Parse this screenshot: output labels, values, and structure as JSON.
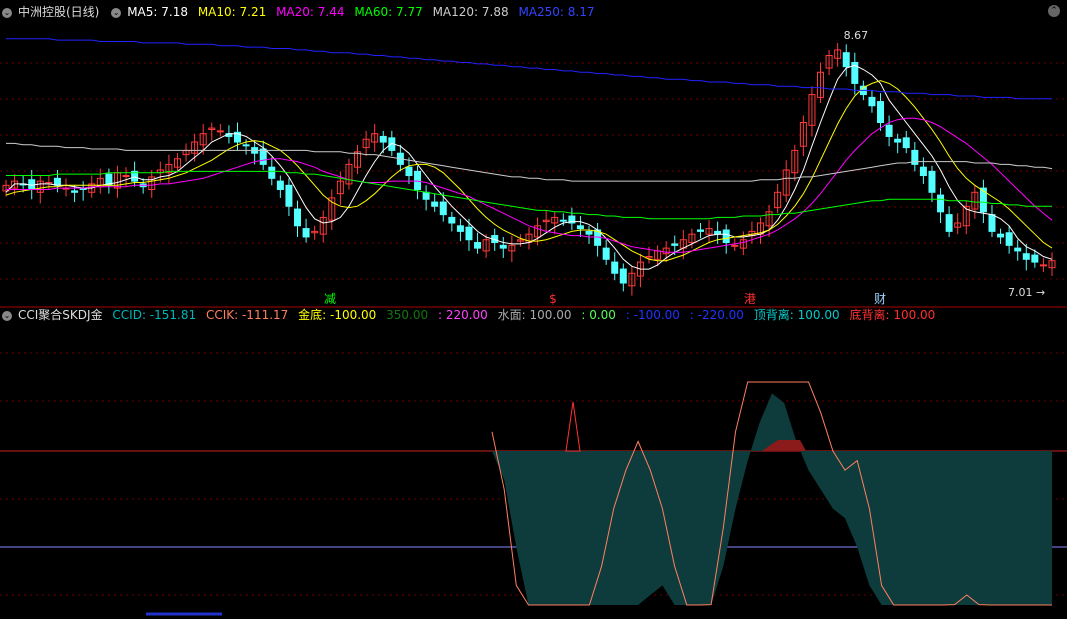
{
  "colors": {
    "up": "#ff3a3a",
    "down": "#54ffff",
    "bg": "#000000",
    "ma5": "#ffffff",
    "ma10": "#ffff00",
    "ma20": "#ff00ff",
    "ma60": "#00ff00",
    "ma120": "#cccccc",
    "ma250": "#2222ff",
    "grid": "#6b0000",
    "ccid": "#00b7b7",
    "ccik": "#ff8060",
    "jindi": "#ffff00",
    "ding": "#00cccc",
    "di": "#ff3030"
  },
  "top_legend": {
    "title": "中洲控股(日线)",
    "ma5": "MA5: 7.18",
    "ma10": "MA10: 7.21",
    "ma20": "MA20: 7.44",
    "ma60": "MA60: 7.77",
    "ma120": "MA120: 7.88",
    "ma250": "MA250: 8.17"
  },
  "bottom_legend": {
    "title": "CCI聚合SKDJ金",
    "ccid": "CCID: -151.81",
    "ccik": "CCIK: -111.17",
    "jindi": "金底: -100.00",
    "v350": "350.00",
    "v220": ": 220.00",
    "shuimian": "水面: 100.00",
    "v0": ": 0.00",
    "vm100": ": -100.00",
    "vm220": ": -220.00",
    "dingbeili": "顶背离: 100.00",
    "dibeili": "底背离: 100.00"
  },
  "annotations": {
    "high_label": "8.67",
    "low_label": "7.01",
    "markers": [
      {
        "text": "减",
        "color": "#00ff00"
      },
      {
        "text": "$",
        "color": "#ff3030"
      },
      {
        "text": "港",
        "color": "#ff3030"
      },
      {
        "text": "财",
        "color": "#9fd0ff"
      }
    ]
  },
  "chart_data": [
    {
      "type": "candlestick",
      "title": "中洲控股(日线)",
      "high": 8.67,
      "low": 7.01,
      "close": [
        7.55,
        7.58,
        7.56,
        7.52,
        7.58,
        7.57,
        7.55,
        7.53,
        7.5,
        7.52,
        7.56,
        7.6,
        7.55,
        7.64,
        7.62,
        7.58,
        7.54,
        7.61,
        7.66,
        7.7,
        7.74,
        7.8,
        7.86,
        7.92,
        7.96,
        7.94,
        7.9,
        7.86,
        7.84,
        7.78,
        7.7,
        7.6,
        7.52,
        7.4,
        7.26,
        7.18,
        7.22,
        7.32,
        7.46,
        7.58,
        7.7,
        7.79,
        7.88,
        7.92,
        7.86,
        7.8,
        7.7,
        7.62,
        7.52,
        7.45,
        7.4,
        7.34,
        7.28,
        7.22,
        7.16,
        7.1,
        7.16,
        7.14,
        7.1,
        7.12,
        7.16,
        7.2,
        7.26,
        7.3,
        7.32,
        7.3,
        7.28,
        7.24,
        7.2,
        7.12,
        7.02,
        6.92,
        6.85,
        6.92,
        7.0,
        7.04,
        7.08,
        7.1,
        7.12,
        7.16,
        7.2,
        7.22,
        7.24,
        7.2,
        7.14,
        7.12,
        7.16,
        7.22,
        7.28,
        7.36,
        7.5,
        7.66,
        7.8,
        8.0,
        8.2,
        8.36,
        8.48,
        8.52,
        8.4,
        8.28,
        8.2,
        8.12,
        8.0,
        7.9,
        7.86,
        7.82,
        7.7,
        7.62,
        7.5,
        7.36,
        7.22,
        7.28,
        7.4,
        7.5,
        7.36,
        7.22,
        7.18,
        7.12,
        7.08,
        7.02,
        7.0,
        6.98,
        7.01
      ],
      "series": [
        {
          "name": "MA5",
          "values": [
            7.5,
            7.56,
            7.56,
            7.55,
            7.56,
            7.56,
            7.55,
            7.55,
            7.54,
            7.53,
            7.53,
            7.55,
            7.56,
            7.57,
            7.59,
            7.61,
            7.59,
            7.59,
            7.61,
            7.62,
            7.65,
            7.7,
            7.75,
            7.8,
            7.86,
            7.89,
            7.92,
            7.92,
            7.9,
            7.86,
            7.82,
            7.76,
            7.69,
            7.61,
            7.5,
            7.39,
            7.31,
            7.28,
            7.29,
            7.32,
            7.4,
            7.51,
            7.62,
            7.72,
            7.8,
            7.85,
            7.83,
            7.78,
            7.7,
            7.62,
            7.54,
            7.47,
            7.4,
            7.34,
            7.28,
            7.22,
            7.18,
            7.16,
            7.14,
            7.13,
            7.13,
            7.14,
            7.17,
            7.21,
            7.25,
            7.28,
            7.29,
            7.29,
            7.27,
            7.23,
            7.17,
            7.1,
            7.02,
            6.97,
            6.95,
            6.95,
            6.98,
            7.03,
            7.07,
            7.1,
            7.13,
            7.16,
            7.19,
            7.2,
            7.2,
            7.18,
            7.18,
            7.19,
            7.2,
            7.23,
            7.3,
            7.4,
            7.52,
            7.66,
            7.83,
            8.0,
            8.16,
            8.31,
            8.39,
            8.41,
            8.38,
            8.34,
            8.28,
            8.16,
            8.08,
            8.0,
            7.92,
            7.84,
            7.76,
            7.66,
            7.54,
            7.44,
            7.38,
            7.36,
            7.35,
            7.34,
            7.31,
            7.26,
            7.17,
            7.11,
            7.08,
            7.04,
            7.02
          ]
        },
        {
          "name": "MA10",
          "values": [
            7.48,
            7.5,
            7.51,
            7.52,
            7.53,
            7.54,
            7.54,
            7.55,
            7.55,
            7.55,
            7.55,
            7.55,
            7.55,
            7.55,
            7.56,
            7.57,
            7.57,
            7.58,
            7.59,
            7.6,
            7.62,
            7.64,
            7.67,
            7.7,
            7.73,
            7.77,
            7.81,
            7.84,
            7.86,
            7.87,
            7.86,
            7.83,
            7.8,
            7.75,
            7.69,
            7.62,
            7.55,
            7.48,
            7.43,
            7.4,
            7.39,
            7.4,
            7.44,
            7.49,
            7.55,
            7.61,
            7.66,
            7.69,
            7.7,
            7.7,
            7.68,
            7.64,
            7.58,
            7.52,
            7.45,
            7.38,
            7.32,
            7.27,
            7.23,
            7.2,
            7.17,
            7.15,
            7.15,
            7.16,
            7.18,
            7.2,
            7.22,
            7.23,
            7.23,
            7.22,
            7.2,
            7.16,
            7.12,
            7.08,
            7.05,
            7.02,
            7.01,
            7.01,
            7.03,
            7.05,
            7.08,
            7.11,
            7.14,
            7.16,
            7.17,
            7.18,
            7.19,
            7.2,
            7.21,
            7.23,
            7.27,
            7.33,
            7.4,
            7.49,
            7.6,
            7.73,
            7.86,
            7.99,
            8.1,
            8.19,
            8.25,
            8.28,
            8.3,
            8.28,
            8.24,
            8.18,
            8.11,
            8.03,
            7.95,
            7.86,
            7.76,
            7.67,
            7.6,
            7.55,
            7.51,
            7.47,
            7.43,
            7.38,
            7.32,
            7.26,
            7.2,
            7.14,
            7.1
          ]
        },
        {
          "name": "MA20",
          "values": [
            7.52,
            7.52,
            7.52,
            7.52,
            7.52,
            7.52,
            7.53,
            7.53,
            7.53,
            7.53,
            7.54,
            7.54,
            7.54,
            7.54,
            7.54,
            7.55,
            7.55,
            7.55,
            7.56,
            7.56,
            7.57,
            7.58,
            7.59,
            7.6,
            7.62,
            7.64,
            7.66,
            7.68,
            7.7,
            7.72,
            7.73,
            7.74,
            7.74,
            7.73,
            7.72,
            7.7,
            7.68,
            7.65,
            7.63,
            7.61,
            7.59,
            7.58,
            7.57,
            7.57,
            7.57,
            7.58,
            7.58,
            7.58,
            7.58,
            7.57,
            7.55,
            7.53,
            7.51,
            7.49,
            7.47,
            7.44,
            7.41,
            7.38,
            7.35,
            7.32,
            7.29,
            7.26,
            7.24,
            7.22,
            7.21,
            7.2,
            7.19,
            7.19,
            7.18,
            7.18,
            7.17,
            7.15,
            7.13,
            7.11,
            7.1,
            7.09,
            7.08,
            7.07,
            7.07,
            7.07,
            7.08,
            7.09,
            7.1,
            7.11,
            7.12,
            7.13,
            7.14,
            7.16,
            7.18,
            7.2,
            7.23,
            7.27,
            7.31,
            7.36,
            7.42,
            7.49,
            7.57,
            7.65,
            7.73,
            7.8,
            7.86,
            7.92,
            7.96,
            8.0,
            8.02,
            8.03,
            8.03,
            8.02,
            8.0,
            7.97,
            7.93,
            7.89,
            7.85,
            7.8,
            7.75,
            7.7,
            7.64,
            7.58,
            7.52,
            7.46,
            7.4,
            7.35,
            7.3
          ]
        },
        {
          "name": "MA60",
          "values": [
            7.62,
            7.62,
            7.62,
            7.62,
            7.62,
            7.62,
            7.63,
            7.63,
            7.63,
            7.63,
            7.63,
            7.63,
            7.64,
            7.64,
            7.64,
            7.64,
            7.64,
            7.64,
            7.64,
            7.65,
            7.65,
            7.65,
            7.65,
            7.65,
            7.65,
            7.65,
            7.65,
            7.65,
            7.65,
            7.65,
            7.65,
            7.65,
            7.65,
            7.64,
            7.64,
            7.63,
            7.63,
            7.62,
            7.61,
            7.6,
            7.59,
            7.58,
            7.57,
            7.56,
            7.55,
            7.54,
            7.53,
            7.52,
            7.51,
            7.5,
            7.49,
            7.48,
            7.47,
            7.46,
            7.45,
            7.44,
            7.43,
            7.42,
            7.41,
            7.4,
            7.39,
            7.38,
            7.37,
            7.37,
            7.36,
            7.36,
            7.35,
            7.35,
            7.34,
            7.34,
            7.33,
            7.33,
            7.32,
            7.32,
            7.32,
            7.31,
            7.31,
            7.31,
            7.31,
            7.31,
            7.31,
            7.31,
            7.31,
            7.32,
            7.32,
            7.32,
            7.33,
            7.33,
            7.33,
            7.34,
            7.34,
            7.35,
            7.35,
            7.36,
            7.37,
            7.38,
            7.39,
            7.4,
            7.41,
            7.42,
            7.43,
            7.44,
            7.44,
            7.45,
            7.45,
            7.45,
            7.45,
            7.45,
            7.45,
            7.45,
            7.44,
            7.44,
            7.44,
            7.43,
            7.43,
            7.42,
            7.42,
            7.41,
            7.41,
            7.4,
            7.4,
            7.4,
            7.4
          ]
        },
        {
          "name": "MA120",
          "values": [
            7.85,
            7.85,
            7.84,
            7.84,
            7.83,
            7.83,
            7.83,
            7.82,
            7.82,
            7.82,
            7.81,
            7.81,
            7.81,
            7.81,
            7.8,
            7.8,
            7.8,
            7.8,
            7.8,
            7.8,
            7.8,
            7.8,
            7.8,
            7.8,
            7.8,
            7.8,
            7.8,
            7.8,
            7.8,
            7.8,
            7.8,
            7.8,
            7.8,
            7.8,
            7.8,
            7.8,
            7.79,
            7.79,
            7.79,
            7.79,
            7.78,
            7.78,
            7.77,
            7.77,
            7.76,
            7.75,
            7.74,
            7.73,
            7.72,
            7.71,
            7.7,
            7.69,
            7.68,
            7.67,
            7.66,
            7.65,
            7.64,
            7.63,
            7.62,
            7.61,
            7.61,
            7.6,
            7.6,
            7.59,
            7.59,
            7.59,
            7.58,
            7.58,
            7.58,
            7.58,
            7.58,
            7.58,
            7.58,
            7.58,
            7.58,
            7.58,
            7.58,
            7.58,
            7.58,
            7.58,
            7.58,
            7.58,
            7.58,
            7.58,
            7.58,
            7.58,
            7.58,
            7.58,
            7.59,
            7.59,
            7.59,
            7.6,
            7.6,
            7.61,
            7.61,
            7.62,
            7.63,
            7.64,
            7.65,
            7.66,
            7.67,
            7.68,
            7.69,
            7.7,
            7.71,
            7.71,
            7.72,
            7.72,
            7.72,
            7.72,
            7.72,
            7.72,
            7.72,
            7.71,
            7.71,
            7.71,
            7.7,
            7.7,
            7.69,
            7.69,
            7.68,
            7.68,
            7.67
          ]
        },
        {
          "name": "MA250",
          "values": [
            8.6,
            8.6,
            8.6,
            8.6,
            8.6,
            8.6,
            8.59,
            8.59,
            8.59,
            8.59,
            8.59,
            8.58,
            8.58,
            8.58,
            8.58,
            8.58,
            8.57,
            8.57,
            8.57,
            8.57,
            8.57,
            8.56,
            8.56,
            8.56,
            8.56,
            8.55,
            8.55,
            8.55,
            8.54,
            8.54,
            8.54,
            8.53,
            8.53,
            8.53,
            8.52,
            8.52,
            8.51,
            8.51,
            8.5,
            8.5,
            8.5,
            8.49,
            8.49,
            8.48,
            8.48,
            8.47,
            8.47,
            8.46,
            8.46,
            8.45,
            8.45,
            8.44,
            8.44,
            8.43,
            8.43,
            8.42,
            8.42,
            8.41,
            8.41,
            8.4,
            8.4,
            8.39,
            8.39,
            8.38,
            8.38,
            8.37,
            8.37,
            8.36,
            8.36,
            8.35,
            8.35,
            8.34,
            8.34,
            8.33,
            8.33,
            8.32,
            8.32,
            8.31,
            8.31,
            8.31,
            8.3,
            8.3,
            8.29,
            8.29,
            8.29,
            8.28,
            8.28,
            8.27,
            8.27,
            8.27,
            8.26,
            8.26,
            8.26,
            8.25,
            8.25,
            8.25,
            8.24,
            8.24,
            8.24,
            8.23,
            8.23,
            8.23,
            8.22,
            8.22,
            8.22,
            8.21,
            8.21,
            8.21,
            8.2,
            8.2,
            8.2,
            8.19,
            8.19,
            8.19,
            8.18,
            8.18,
            8.18,
            8.18,
            8.17,
            8.17,
            8.17,
            8.17,
            8.17
          ]
        }
      ]
    },
    {
      "type": "line",
      "title": "CCI聚合SKDJ金",
      "reference_lines": [
        100,
        0,
        -100,
        -220
      ],
      "series": [
        {
          "name": "CCIK",
          "values": [
            120,
            60,
            -40,
            -160,
            -240,
            -260,
            -200,
            -150,
            -90,
            -20,
            40,
            80,
            110,
            80,
            40,
            -20,
            -80,
            -100,
            -60,
            20,
            120,
            200,
            260,
            290,
            260,
            230,
            200,
            140,
            100,
            80,
            90,
            40,
            -40,
            -120,
            -160,
            -170,
            -140,
            -90,
            -60,
            -50,
            -60,
            -90,
            -120,
            -160,
            -170,
            -140,
            -110
          ]
        },
        {
          "name": "CCID",
          "values": [
            100,
            70,
            0,
            -120,
            -200,
            -230,
            -210,
            -180,
            -150,
            -120,
            -110,
            -90,
            -70,
            -50,
            -40,
            -70,
            -100,
            -110,
            -80,
            -20,
            40,
            90,
            130,
            160,
            150,
            110,
            80,
            60,
            40,
            30,
            0,
            -40,
            -70,
            -80,
            -90,
            -100,
            -110,
            -100,
            -90,
            -110,
            -130,
            -140,
            -130,
            -140,
            -150,
            -150,
            -152
          ]
        }
      ]
    }
  ]
}
